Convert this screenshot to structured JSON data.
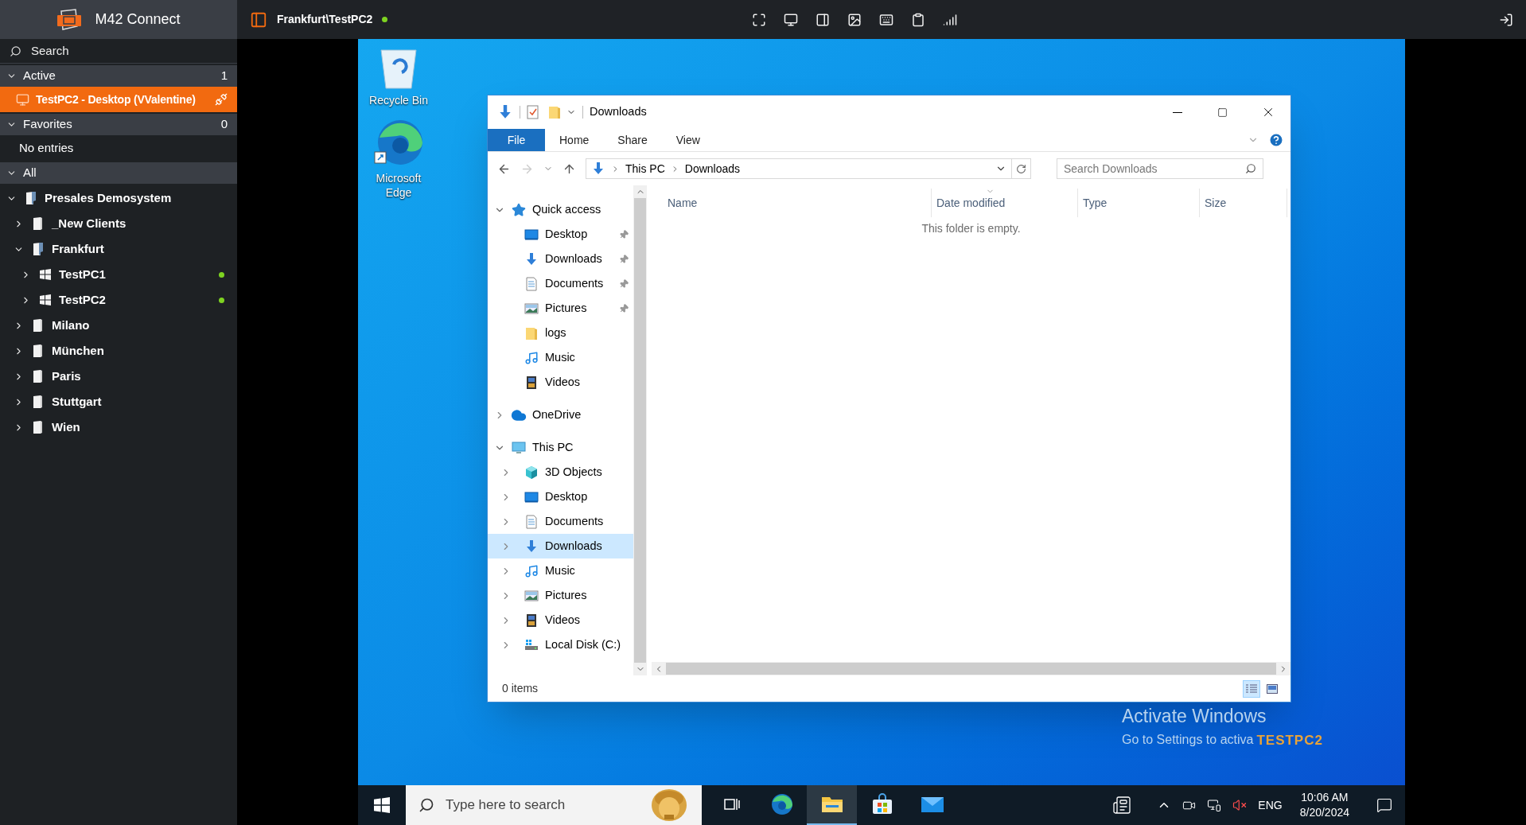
{
  "app": {
    "title": "M42 Connect"
  },
  "sidebar": {
    "search_placeholder": "Search",
    "sections": [
      {
        "kind": "sessions",
        "label": "Active",
        "count": "1",
        "expanded": true,
        "items": [
          {
            "label": "TestPC2 - Desktop (VValentine)",
            "selected": true
          }
        ]
      },
      {
        "kind": "empty",
        "label": "Favorites",
        "count": "0",
        "expanded": true,
        "empty_text": "No entries"
      },
      {
        "kind": "tree",
        "label": "All",
        "expanded": true,
        "tree": [
          {
            "label": "Presales Demosystem",
            "kind": "group",
            "expanded": true,
            "children": [
              {
                "label": "_New Clients",
                "kind": "group",
                "expanded": false
              },
              {
                "label": "Frankfurt",
                "kind": "group",
                "expanded": true,
                "children": [
                  {
                    "label": "TestPC1",
                    "kind": "computer",
                    "expanded": false,
                    "online": true
                  },
                  {
                    "label": "TestPC2",
                    "kind": "computer",
                    "expanded": false,
                    "online": true
                  }
                ]
              },
              {
                "label": "Milano",
                "kind": "group",
                "expanded": false
              },
              {
                "label": "München",
                "kind": "group",
                "expanded": false
              },
              {
                "label": "Paris",
                "kind": "group",
                "expanded": false
              },
              {
                "label": "Stuttgart",
                "kind": "group",
                "expanded": false
              },
              {
                "label": "Wien",
                "kind": "group",
                "expanded": false
              }
            ]
          }
        ]
      }
    ]
  },
  "session": {
    "title": "Frankfurt\\TestPC2",
    "connected": true
  },
  "remote": {
    "desktop_icons": [
      {
        "kind": "recycle-bin",
        "label": "Recycle Bin"
      },
      {
        "kind": "edge",
        "label": "Microsoft Edge"
      }
    ],
    "explorer": {
      "title": "Downloads",
      "ribbon_tabs": [
        {
          "kind": "file",
          "label": "File"
        },
        {
          "kind": "tab",
          "label": "Home"
        },
        {
          "kind": "tab",
          "label": "Share"
        },
        {
          "kind": "tab",
          "label": "View"
        }
      ],
      "address": [
        "This PC",
        "Downloads"
      ],
      "search_placeholder": "Search Downloads",
      "navigation": [
        {
          "label": "Quick access",
          "kind": "star",
          "expanded": true,
          "selected": false,
          "children": [
            {
              "label": "Desktop",
              "kind": "desktop",
              "pinned": true,
              "selected": false
            },
            {
              "label": "Downloads",
              "kind": "download",
              "pinned": true,
              "selected": false
            },
            {
              "label": "Documents",
              "kind": "documents",
              "pinned": true,
              "selected": false
            },
            {
              "label": "Pictures",
              "kind": "pictures",
              "pinned": true,
              "selected": false
            },
            {
              "label": "logs",
              "kind": "folder",
              "pinned": false,
              "selected": false
            },
            {
              "label": "Music",
              "kind": "music",
              "pinned": false,
              "selected": false
            },
            {
              "label": "Videos",
              "kind": "videos",
              "pinned": false,
              "selected": false
            }
          ]
        },
        {
          "label": "OneDrive",
          "kind": "cloud",
          "expanded": false,
          "selected": false
        },
        {
          "label": "This PC",
          "kind": "pc",
          "expanded": true,
          "selected": false,
          "children": [
            {
              "label": "3D Objects",
              "kind": "cube",
              "expanded": false,
              "selected": false
            },
            {
              "label": "Desktop",
              "kind": "desktop",
              "expanded": false,
              "selected": false
            },
            {
              "label": "Documents",
              "kind": "documents",
              "expanded": false,
              "selected": false
            },
            {
              "label": "Downloads",
              "kind": "download",
              "expanded": false,
              "selected": true
            },
            {
              "label": "Music",
              "kind": "music",
              "expanded": false,
              "selected": false
            },
            {
              "label": "Pictures",
              "kind": "pictures",
              "expanded": false,
              "selected": false
            },
            {
              "label": "Videos",
              "kind": "videos",
              "expanded": false,
              "selected": false
            },
            {
              "label": "Local Disk (C:)",
              "kind": "disk",
              "expanded": false,
              "selected": false
            }
          ]
        }
      ],
      "columns": [
        {
          "label": "Name",
          "sorted": false
        },
        {
          "label": "Date modified",
          "sorted": true
        },
        {
          "label": "Type",
          "sorted": false
        },
        {
          "label": "Size",
          "sorted": false
        }
      ],
      "empty_text": "This folder is empty.",
      "status": "0 items",
      "views": [
        {
          "kind": "details",
          "selected": true
        },
        {
          "kind": "large-icons",
          "selected": false
        }
      ]
    },
    "activation": {
      "title": "Activate Windows",
      "text": "Go to Settings to activa"
    },
    "computer_label": "TESTPC2",
    "taskbar": {
      "search_placeholder": "Type here to search",
      "apps": [
        {
          "kind": "task-view",
          "active": false
        },
        {
          "kind": "edge",
          "active": false
        },
        {
          "kind": "explorer",
          "active": true
        },
        {
          "kind": "store",
          "active": false
        },
        {
          "kind": "mail",
          "active": false
        }
      ],
      "muted": true,
      "language": "ENG",
      "time": "10:06 AM",
      "date": "8/20/2024"
    }
  }
}
